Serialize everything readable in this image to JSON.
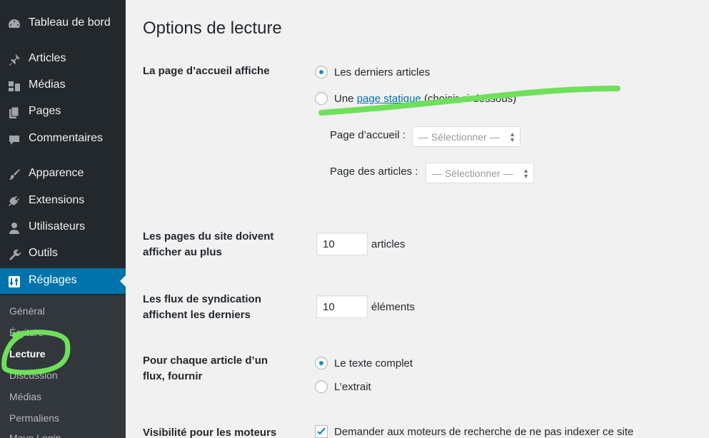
{
  "sidebar": {
    "items": [
      {
        "label": "Tableau de bord",
        "icon": "dashboard-icon"
      },
      {
        "label": "Articles",
        "icon": "pin-icon"
      },
      {
        "label": "Médias",
        "icon": "media-icon"
      },
      {
        "label": "Pages",
        "icon": "pages-icon"
      },
      {
        "label": "Commentaires",
        "icon": "comments-icon"
      },
      {
        "label": "Apparence",
        "icon": "brush-icon"
      },
      {
        "label": "Extensions",
        "icon": "plugin-icon"
      },
      {
        "label": "Utilisateurs",
        "icon": "user-icon"
      },
      {
        "label": "Outils",
        "icon": "wrench-icon"
      },
      {
        "label": "Réglages",
        "icon": "settings-icon"
      }
    ],
    "submenu": [
      "Général",
      "Écriture",
      "Lecture",
      "Discussion",
      "Médias",
      "Permaliens",
      "Mayo Login"
    ],
    "accent_color": "#0073aa"
  },
  "main": {
    "title": "Options de lecture",
    "front_page": {
      "label": "La page d’accueil affiche",
      "option_latest": "Les derniers articles",
      "option_static_prefix": "Une",
      "option_static_link": "page statique",
      "option_static_suffix": "(choisir ci-dessous)",
      "homepage_label": "Page d’accueil :",
      "homepage_select": "— Sélectionner —",
      "posts_page_label": "Page des articles :",
      "posts_page_select": "— Sélectionner —"
    },
    "posts_per_page": {
      "label_line1": "Les pages du site doivent",
      "label_line2": "afficher au plus",
      "value": "10",
      "unit": "articles"
    },
    "posts_per_rss": {
      "label_line1": "Les flux de syndication",
      "label_line2": "affichent les derniers",
      "value": "10",
      "unit": "éléments"
    },
    "feed_content": {
      "label_line1": "Pour chaque article d’un",
      "label_line2": "flux, fournir",
      "option_full": "Le texte complet",
      "option_excerpt": "L’extrait"
    },
    "visibility": {
      "label": "Visibilité pour les moteurs",
      "checkbox_label": "Demander aux moteurs de recherche de ne pas indexer ce site"
    }
  },
  "annotation_color": "#6ee05a"
}
